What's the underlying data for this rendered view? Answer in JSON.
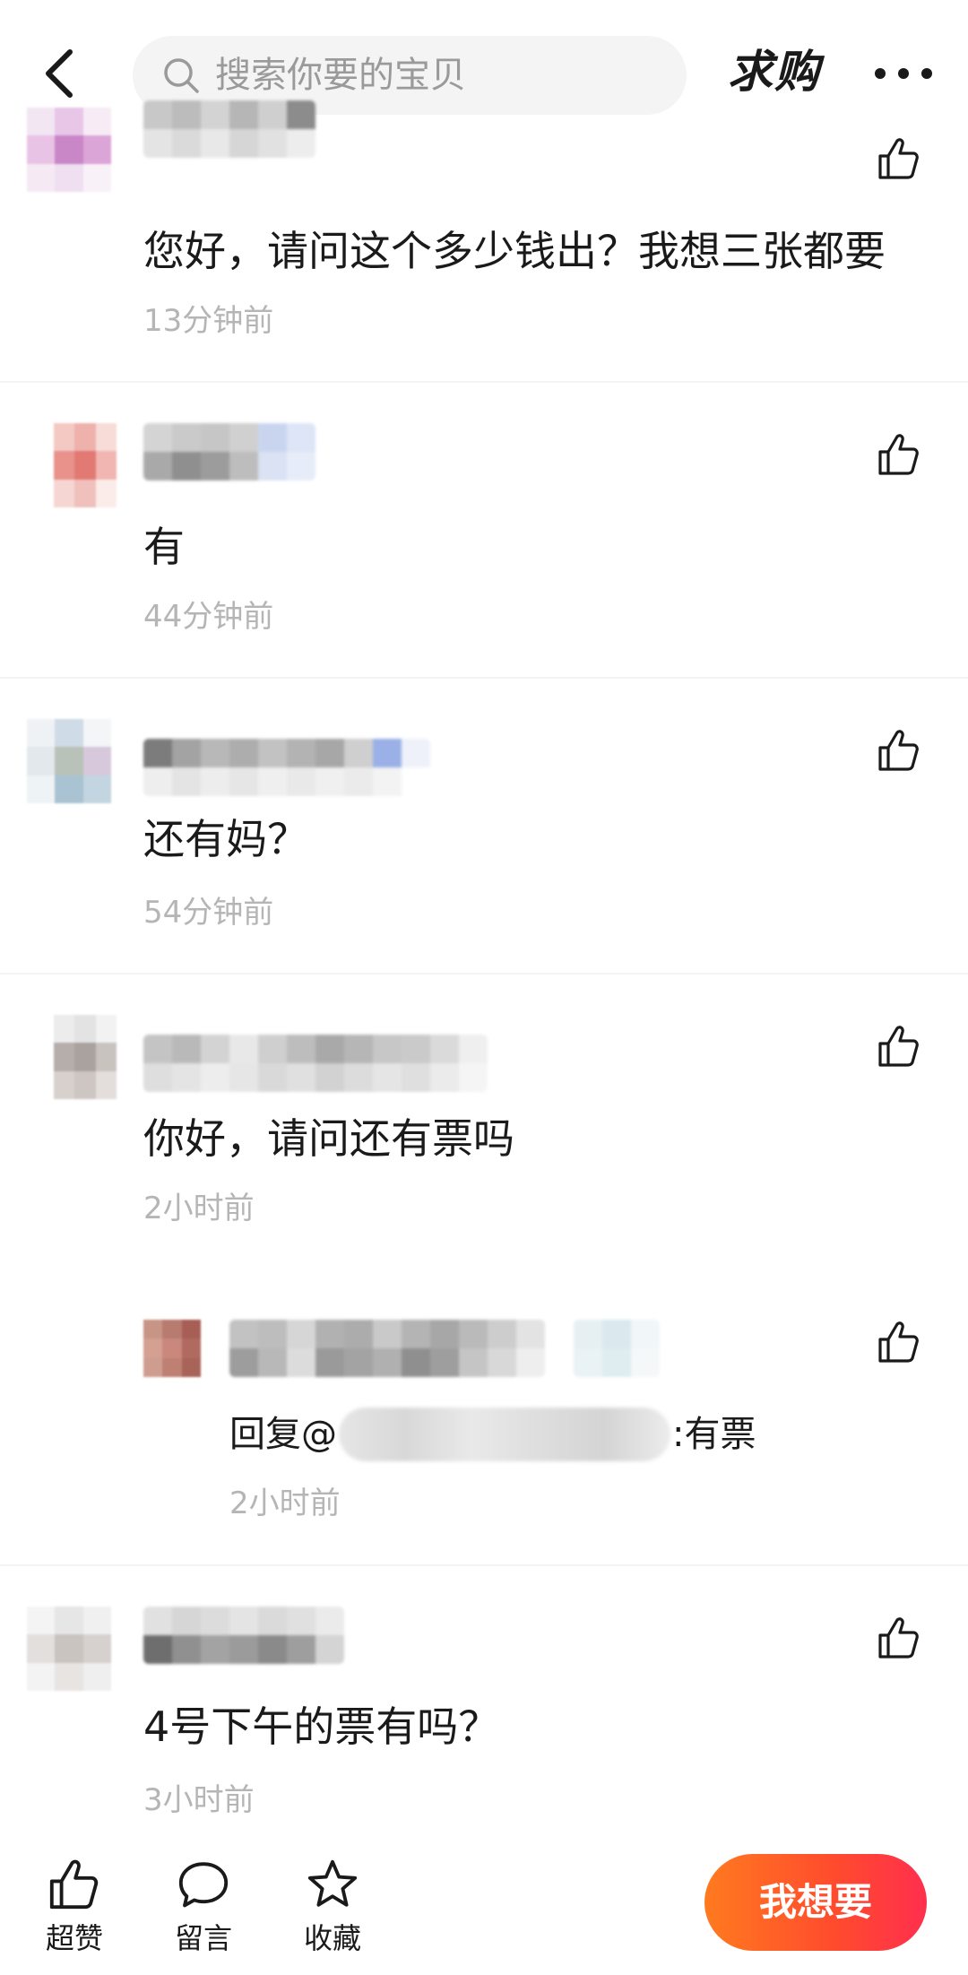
{
  "header": {
    "search_placeholder": "搜索你要的宝贝",
    "tag": "求购"
  },
  "comments": [
    {
      "text": "您好，请问这个多少钱出？我想三张都要",
      "time": "13分钟前"
    },
    {
      "text": "有",
      "time": "44分钟前"
    },
    {
      "text": "还有妈？",
      "time": "54分钟前"
    },
    {
      "text": "你好，请问还有票吗",
      "time": "2小时前"
    },
    {
      "text": "4号下午的票有吗？",
      "time": "3小时前"
    }
  ],
  "reply": {
    "prefix": "回复@",
    "suffix": ":有票",
    "time": "2小时前"
  },
  "bottom_bar": {
    "like_label": "超赞",
    "comment_label": "留言",
    "favorite_label": "收藏",
    "want_label": "我想要"
  },
  "colors": {
    "want_gradient_start": "#ff7a1f",
    "want_gradient_end": "#ff2f4e",
    "time_gray": "#b5b5b5"
  }
}
